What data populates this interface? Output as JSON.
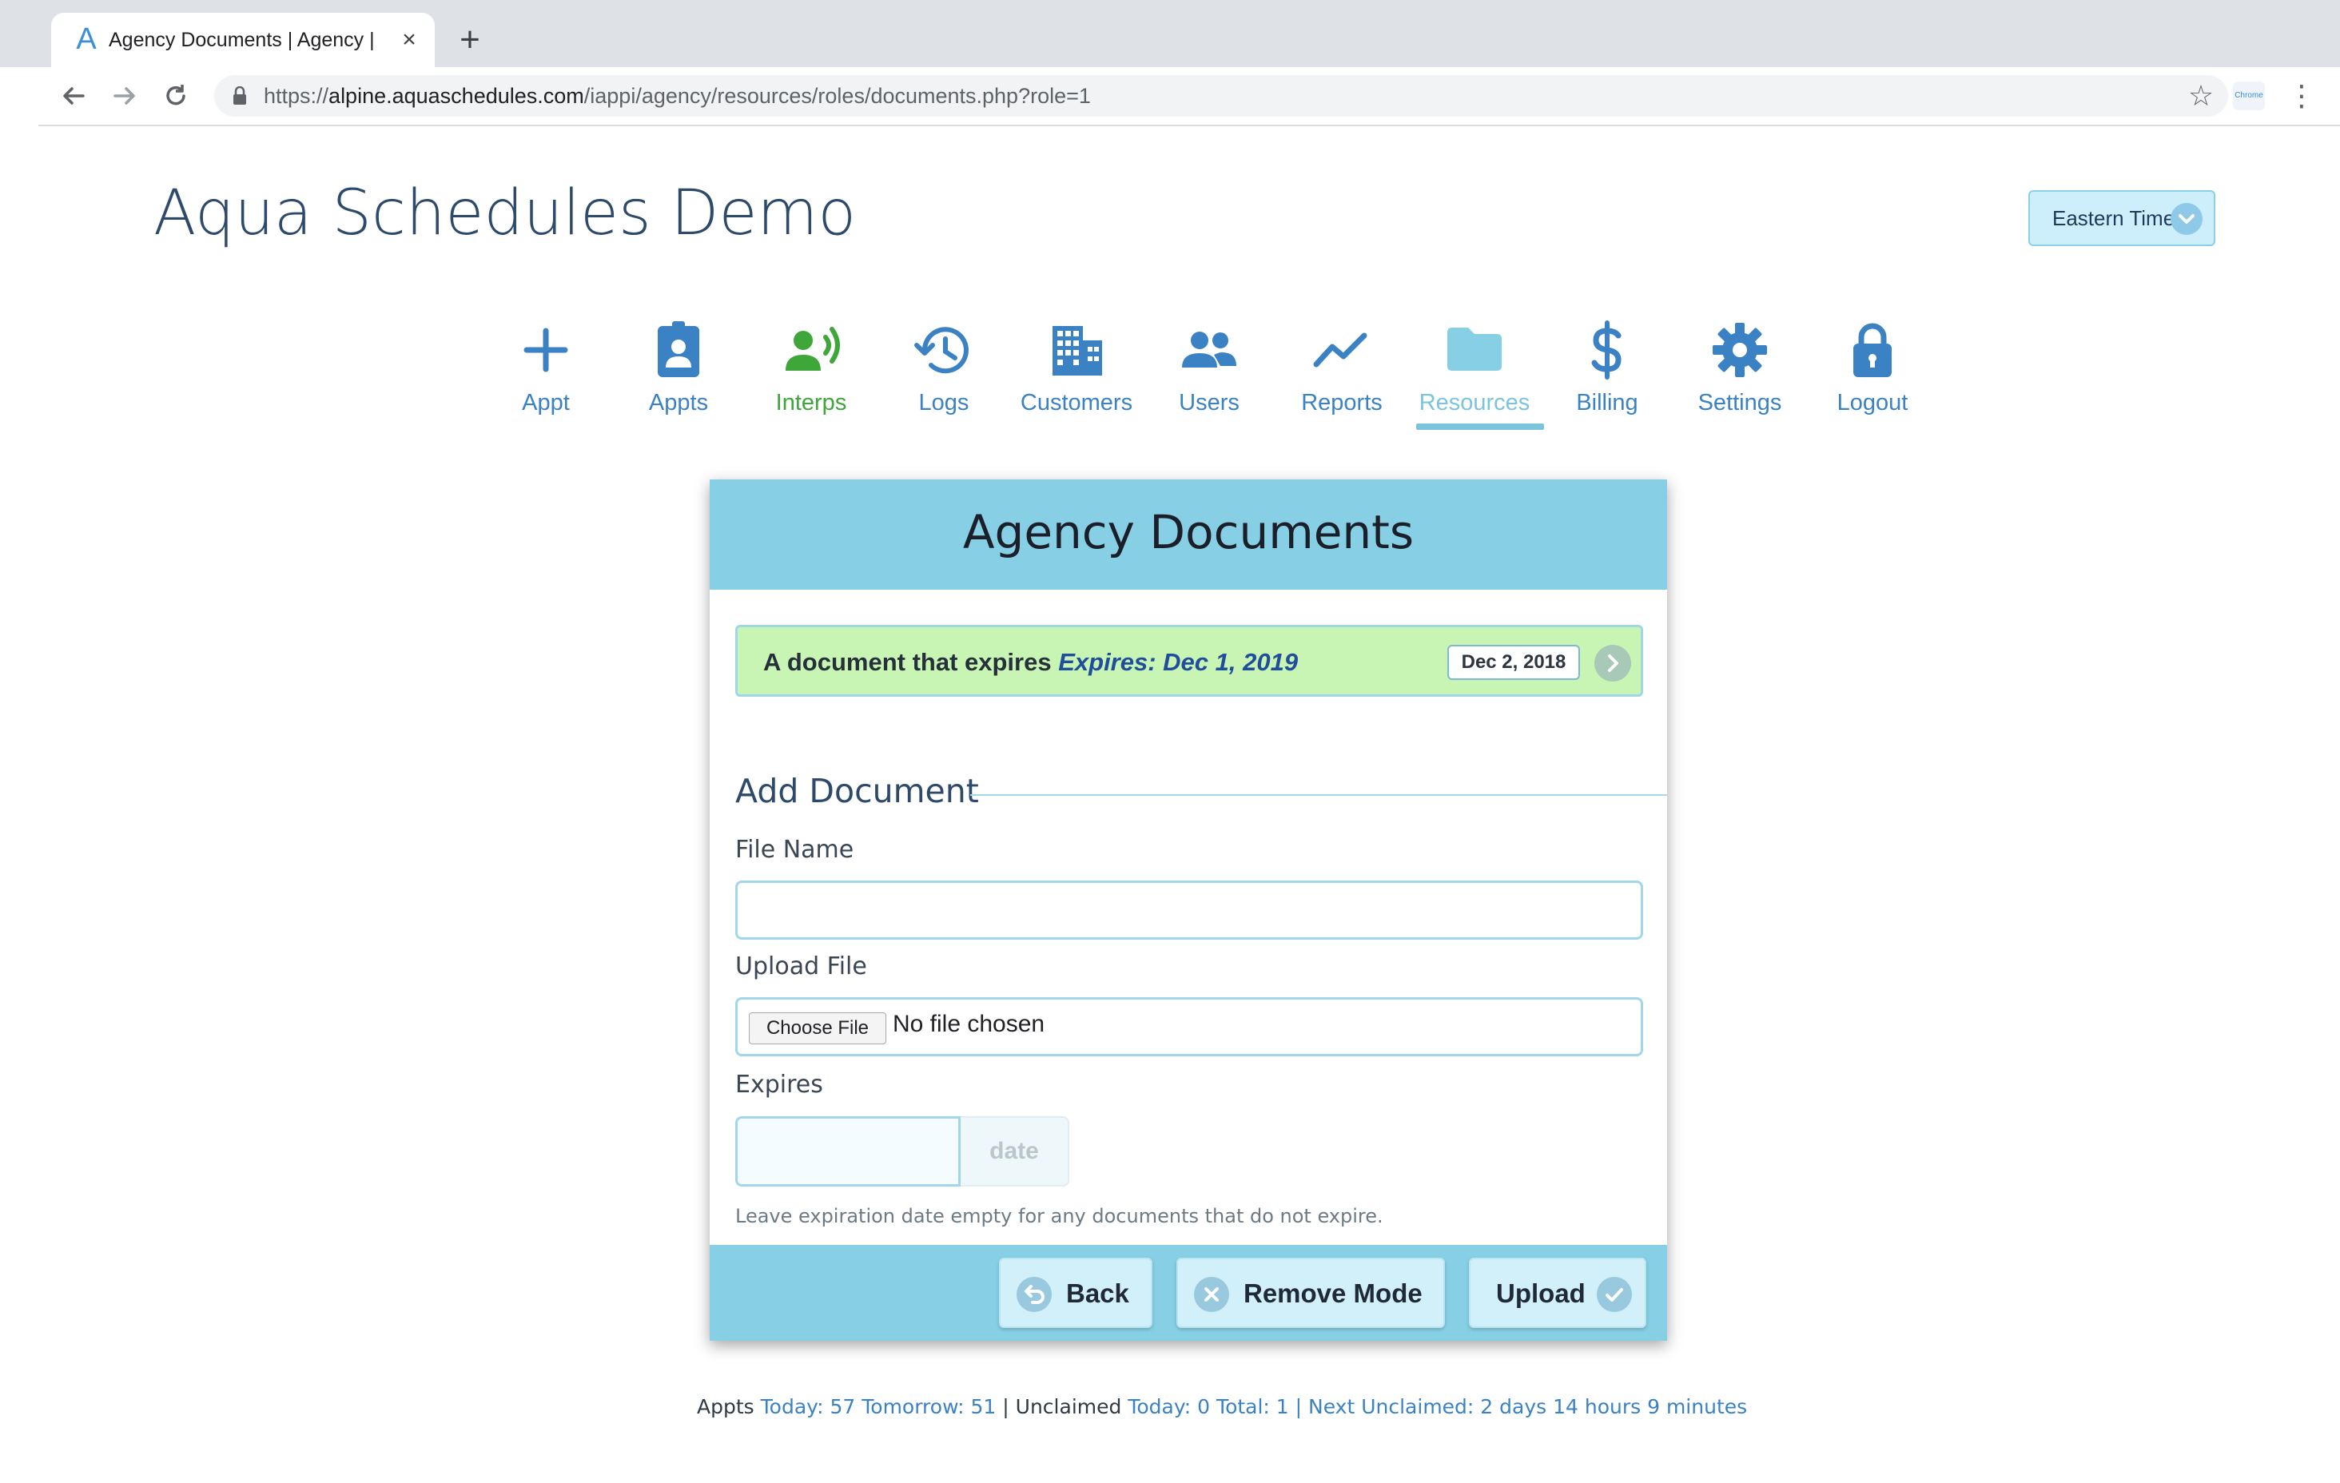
{
  "browser": {
    "tab_title": "Agency Documents | Agency |",
    "tab_logo": "A",
    "url_scheme": "https://",
    "url_host": "alpine.aquaschedules.com",
    "url_path": "/iappi/agency/resources/roles/documents.php?role=1",
    "extension_label": "Chrome"
  },
  "app": {
    "title": "Aqua Schedules Demo",
    "timezone": "Eastern Time"
  },
  "nav": {
    "items": [
      {
        "label": "Appt",
        "icon": "plus-icon"
      },
      {
        "label": "Appts",
        "icon": "badge-icon"
      },
      {
        "label": "Interps",
        "icon": "speaking-person-icon"
      },
      {
        "label": "Logs",
        "icon": "history-icon"
      },
      {
        "label": "Customers",
        "icon": "building-icon"
      },
      {
        "label": "Users",
        "icon": "users-icon"
      },
      {
        "label": "Reports",
        "icon": "chart-line-icon"
      },
      {
        "label": "Resources",
        "icon": "folder-icon"
      },
      {
        "label": "Billing",
        "icon": "dollar-icon"
      },
      {
        "label": "Settings",
        "icon": "gear-icon"
      },
      {
        "label": "Logout",
        "icon": "lock-icon"
      }
    ],
    "active": "Resources"
  },
  "card": {
    "title": "Agency Documents",
    "document": {
      "name": "A document that expires",
      "expires": "Expires: Dec 1, 2019",
      "date": "Dec 2, 2018"
    },
    "section_title": "Add Document",
    "file_name_label": "File Name",
    "file_name_value": "",
    "upload_label": "Upload File",
    "choose_file": "Choose File",
    "no_file": "No file chosen",
    "expires_label": "Expires",
    "date_addon": "date",
    "help_text": "Leave expiration date empty for any documents that do not expire.",
    "buttons": {
      "back": "Back",
      "remove_mode": "Remove Mode",
      "upload": "Upload"
    }
  },
  "stats": {
    "appts_label": "Appts",
    "today": "Today: 57",
    "tomorrow": "Tomorrow: 51",
    "unclaimed_label": "| Unclaimed",
    "unclaimed_today": "Today: 0",
    "total": "Total: 1",
    "next_unclaimed": "| Next Unclaimed: 2 days 14 hours 9 minutes"
  },
  "colors": {
    "link_blue": "#3b82c4",
    "interps_green": "#3fa63a",
    "active_teal": "#7cc4dc",
    "header_teal": "#86cfe4",
    "document_green": "#c8f5b3"
  }
}
